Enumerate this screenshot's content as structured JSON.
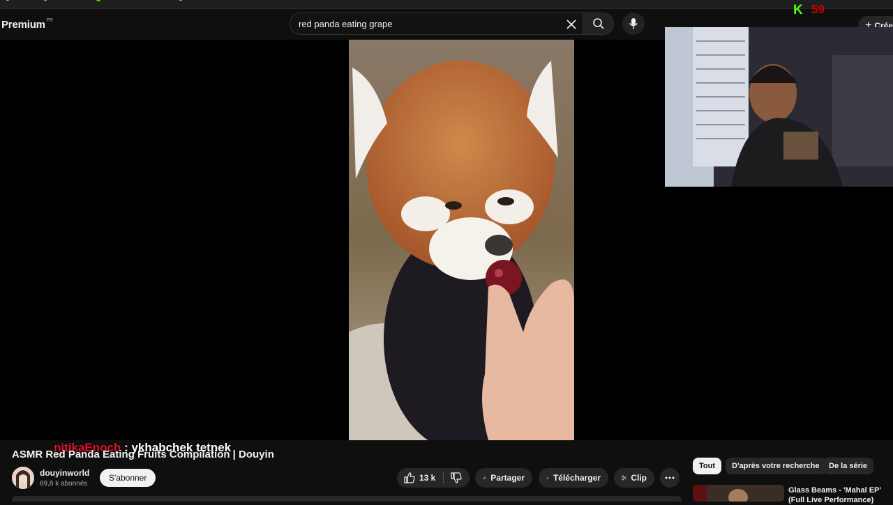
{
  "header": {
    "logo_text": "Premium",
    "logo_region": "FR",
    "search_value": "red panda eating grape",
    "create_label": "Crée"
  },
  "overlay": {
    "kick_logo": "K",
    "kick_count": "59",
    "chat_user": "nitikaEnoch",
    "chat_message": " : ykhabchek tetnek"
  },
  "video": {
    "title": "ASMR Red Panda Eating Fruits Compilation | Douyin",
    "channel_name": "douyinworld",
    "subscribers": "89,8 k abonnés",
    "subscribe_label": "S'abonner",
    "likes": "13 k",
    "share_label": "Partager",
    "download_label": "Télécharger",
    "clip_label": "Clip"
  },
  "chips": [
    "Tout",
    "D'après votre recherche",
    "De la série"
  ],
  "recommendations": [
    {
      "title": "Glass Beams - 'Mahal EP' (Full Live Performance)"
    }
  ],
  "colors": {
    "background": "#0f0f0f",
    "kick_green": "#53fc18",
    "chat_user_red": "#e0102c"
  }
}
